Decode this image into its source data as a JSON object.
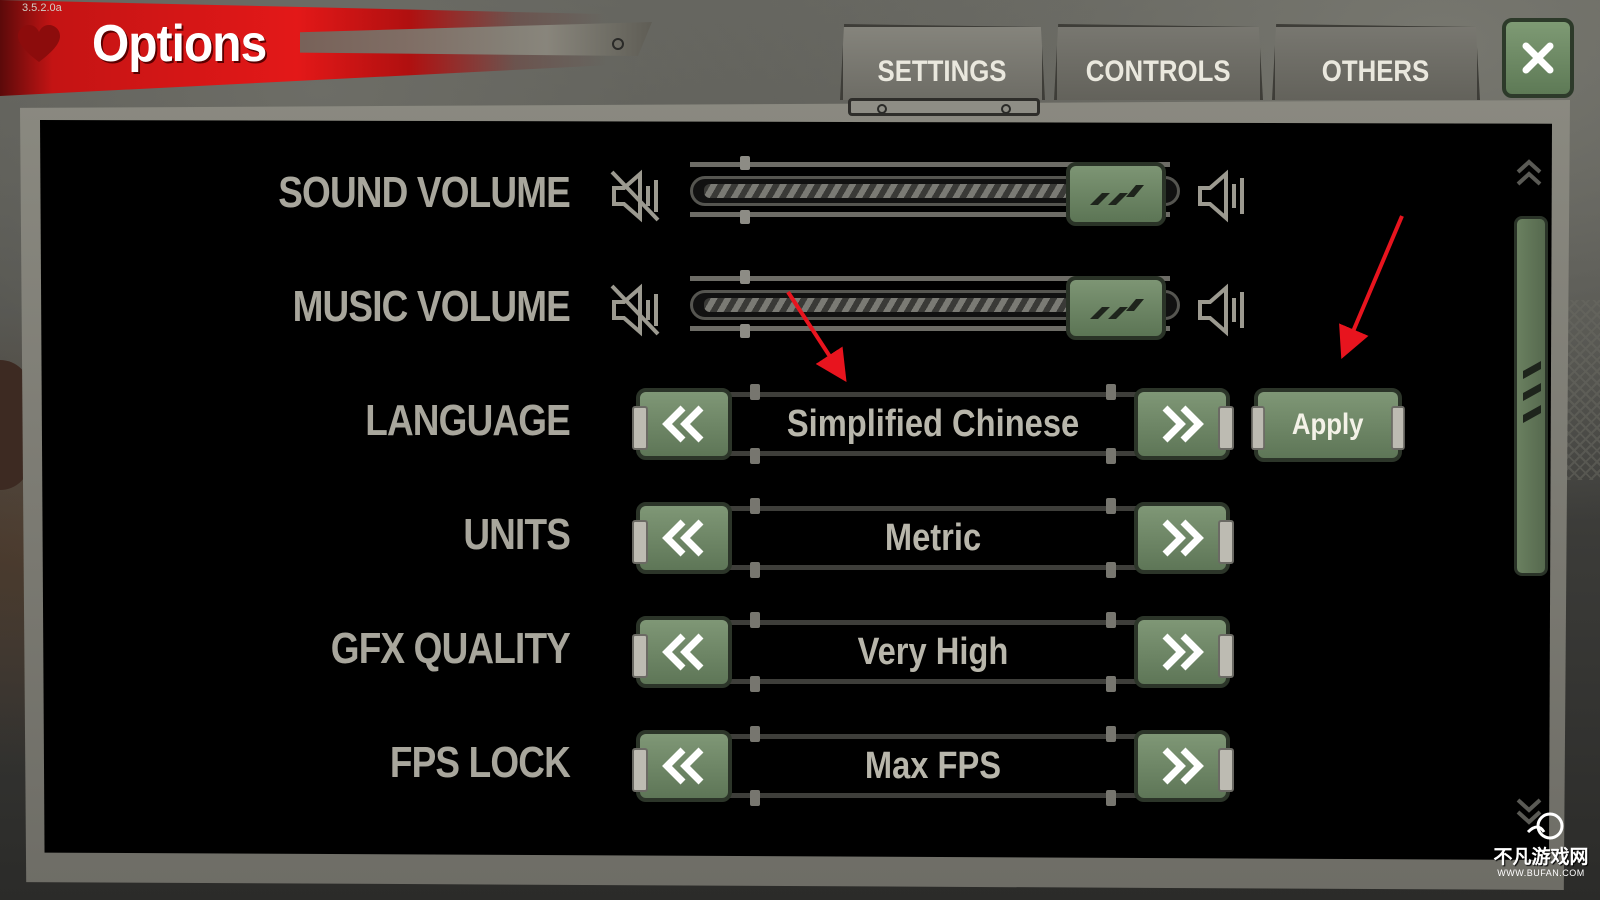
{
  "header": {
    "title": "Options",
    "version": "3.5.2.0a",
    "heart_icon": "heart-icon",
    "close_icon": "close-icon"
  },
  "tabs": [
    {
      "label": "SETTINGS",
      "active": true
    },
    {
      "label": "CONTROLS",
      "active": false
    },
    {
      "label": "OTHERS",
      "active": false
    }
  ],
  "settings": {
    "sound_volume": {
      "label": "SOUND VOLUME",
      "level": 1.0,
      "mute_icon": "speaker-mute-icon",
      "max_icon": "speaker-max-icon"
    },
    "music_volume": {
      "label": "MUSIC VOLUME",
      "level": 1.0,
      "mute_icon": "speaker-mute-icon",
      "max_icon": "speaker-max-icon"
    },
    "language": {
      "label": "LANGUAGE",
      "value": "Simplified Chinese"
    },
    "units": {
      "label": "UNITS",
      "value": "Metric"
    },
    "gfx_quality": {
      "label": "GFX QUALITY",
      "value": "Very High"
    },
    "fps_lock": {
      "label": "FPS LOCK",
      "value": "Max FPS"
    }
  },
  "apply_label": "Apply",
  "watermark": {
    "text": "不凡游戏网",
    "url": "WWW.BUFAN.COM"
  },
  "colors": {
    "banner_red": "#e31818",
    "panel_bg": "#000000",
    "button_green": "#6f8868",
    "label_gray": "#a8a69c",
    "annotation_red": "#e8141e"
  }
}
